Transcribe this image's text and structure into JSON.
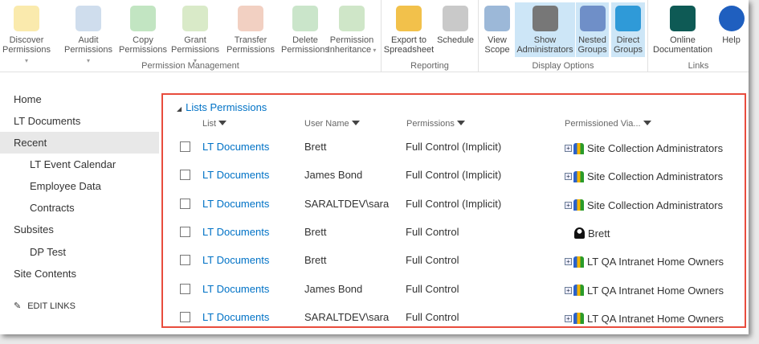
{
  "ribbon": {
    "groups": [
      {
        "label": "Permission Management",
        "buttons": [
          {
            "label1": "Discover",
            "label2": "Permissions",
            "dropdown": true,
            "icon": "lock-icon",
            "color": "#f5d86a"
          },
          {
            "label1": "Audit",
            "label2": "Permissions",
            "dropdown": true,
            "icon": "notebook-key-icon",
            "color": "#a7c1de"
          },
          {
            "label1": "Copy",
            "label2": "Permissions",
            "dropdown": false,
            "icon": "copy-users-icon",
            "color": "#8fcf8f"
          },
          {
            "label1": "Grant",
            "label2": "Permissions",
            "dropdown": true,
            "icon": "user-icon",
            "color": "#b9d99a"
          },
          {
            "label1": "Transfer",
            "label2": "Permissions",
            "dropdown": false,
            "icon": "transfer-users-icon",
            "color": "#e8a98f"
          },
          {
            "label1": "Delete",
            "label2": "Permissions",
            "dropdown": false,
            "icon": "delete-user-icon",
            "color": "#9fcf9f"
          },
          {
            "label1": "Permission",
            "label2": "Inheritance",
            "dropdown": true,
            "icon": "hierarchy-icon",
            "color": "#a7d19a"
          }
        ]
      },
      {
        "label": "Reporting",
        "buttons": [
          {
            "label1": "Export to",
            "label2": "Spreadsheet",
            "icon": "spreadsheet-export-icon",
            "color": "#f2c14b"
          },
          {
            "label1": "Schedule",
            "label2": "",
            "icon": "calendar-clock-icon",
            "color": "#c9c9c9"
          }
        ]
      },
      {
        "label": "Display Options",
        "buttons": [
          {
            "label1": "View",
            "label2": "Scope",
            "icon": "checklist-icon",
            "color": "#9cb8d8"
          },
          {
            "label1": "Show",
            "label2": "Administrators",
            "icon": "administrator-icon",
            "color": "#777777"
          },
          {
            "label1": "Nested",
            "label2": "Groups",
            "icon": "nested-groups-icon",
            "color": "#6f8fc8"
          },
          {
            "label1": "Direct",
            "label2": "Groups",
            "icon": "direct-groups-icon",
            "color": "#2f9ad8"
          }
        ]
      },
      {
        "label": "Links",
        "buttons": [
          {
            "label1": "Online",
            "label2": "Documentation",
            "icon": "book-icon",
            "color": "#0e5a55"
          },
          {
            "label1": "Help",
            "label2": "",
            "icon": "help-icon",
            "color": "#1f5fbf"
          }
        ]
      }
    ]
  },
  "nav": {
    "items": [
      "Home",
      "LT Documents",
      "Recent",
      "LT Event Calendar",
      "Employee Data",
      "Contracts",
      "Subsites",
      "DP Test",
      "Site Contents"
    ],
    "edit_links": "EDIT LINKS"
  },
  "section": {
    "title": "Lists Permissions",
    "columns": [
      "List",
      "User Name",
      "Permissions",
      "Permissioned Via..."
    ]
  },
  "rows": [
    {
      "list": "LT Documents",
      "user": "Brett",
      "permission": "Full Control (Implicit)",
      "via": "Site Collection Administrators",
      "via_type": "group"
    },
    {
      "list": "LT Documents",
      "user": "James Bond",
      "permission": "Full Control (Implicit)",
      "via": "Site Collection Administrators",
      "via_type": "group"
    },
    {
      "list": "LT Documents",
      "user": "SARALTDEV\\sara",
      "permission": "Full Control (Implicit)",
      "via": "Site Collection Administrators",
      "via_type": "group"
    },
    {
      "list": "LT Documents",
      "user": "Brett",
      "permission": "Full Control",
      "via": "Brett",
      "via_type": "user"
    },
    {
      "list": "LT Documents",
      "user": "Brett",
      "permission": "Full Control",
      "via": "LT QA Intranet Home Owners",
      "via_type": "group"
    },
    {
      "list": "LT Documents",
      "user": "James Bond",
      "permission": "Full Control",
      "via": "LT QA Intranet Home Owners",
      "via_type": "group"
    },
    {
      "list": "LT Documents",
      "user": "SARALTDEV\\sara",
      "permission": "Full Control",
      "via": "LT QA Intranet Home Owners",
      "via_type": "group"
    }
  ]
}
